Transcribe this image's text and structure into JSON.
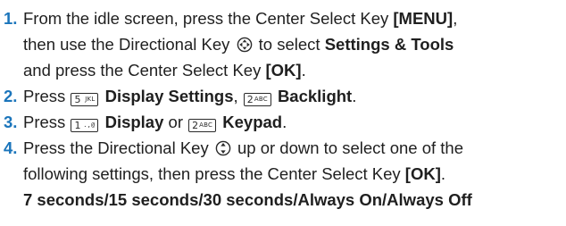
{
  "steps": [
    {
      "num": "1.",
      "parts": {
        "a": "From the idle screen, press the Center Select Key ",
        "b": "[MENU]",
        "c": ",",
        "d": "then use the Directional Key ",
        "e": " to select ",
        "f": "Settings & Tools",
        "g": "and press the Center Select Key ",
        "h": "[OK]",
        "i": "."
      },
      "icons": [
        "four-way-directional-key-icon"
      ]
    },
    {
      "num": "2.",
      "parts": {
        "a": "Press ",
        "b": "Display Settings",
        "c": ", ",
        "d": "Backlight",
        "e": "."
      },
      "keys": [
        {
          "digit": "5",
          "letters": "JKL"
        },
        {
          "digit": "2",
          "letters": "ABC"
        }
      ]
    },
    {
      "num": "3.",
      "parts": {
        "a": "Press ",
        "b": "Display",
        "c": " or ",
        "d": "Keypad",
        "e": "."
      },
      "keys": [
        {
          "digit": "1",
          "letters": ".,@"
        },
        {
          "digit": "2",
          "letters": "ABC"
        }
      ]
    },
    {
      "num": "4.",
      "parts": {
        "a": "Press the Directional Key ",
        "b": " up or down to select one of the",
        "c": "following settings, then press the Center Select Key ",
        "d": "[OK]",
        "e": ".",
        "f": "7 seconds/15 seconds/30 seconds/Always On/Always Off"
      },
      "icons": [
        "up-down-directional-key-icon"
      ]
    }
  ],
  "colors": {
    "step_number": "#1b75bb",
    "text": "#1f1f1f"
  }
}
